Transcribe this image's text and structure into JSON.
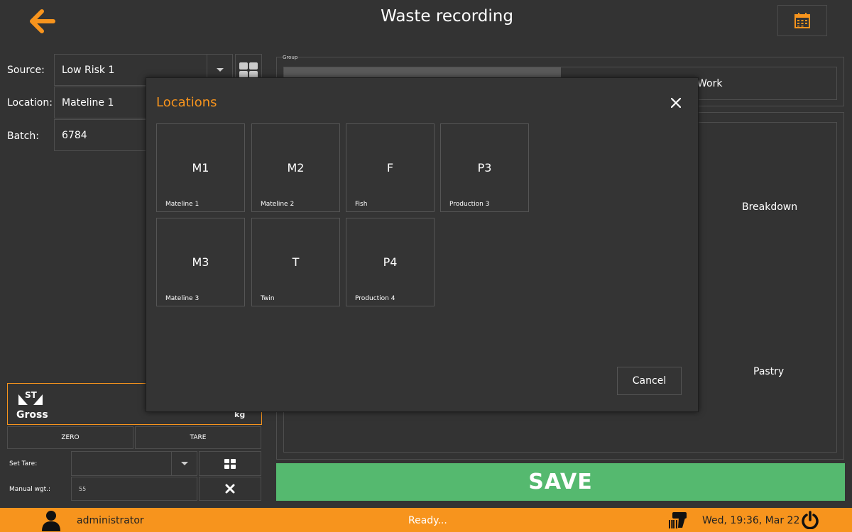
{
  "header": {
    "title": "Waste recording",
    "back_icon": "arrow-left-icon",
    "calendar_icon": "calendar-icon",
    "accent_color": "#f7941d"
  },
  "form": {
    "source_label": "Source:",
    "source_value": "Low Risk 1",
    "location_label": "Location:",
    "location_value": "Mateline 1",
    "batch_label": "Batch:",
    "batch_value": "6784"
  },
  "group": {
    "legend": "Group",
    "partial_label": "Work"
  },
  "categories": {
    "breakdown": "Breakdown",
    "pastry": "Pastry"
  },
  "weight": {
    "stability_icon": "stable-weight-icon",
    "stability_label": "ST",
    "mode": "Gross",
    "unit": "kg",
    "zero_label": "ZERO",
    "tare_label": "TARE",
    "set_tare_label": "Set Tare:",
    "set_tare_value": "",
    "manual_label": "Manual wgt.:",
    "manual_value": "55"
  },
  "save_label": "SAVE",
  "save_color": "#55b96f",
  "footer": {
    "user": "administrator",
    "status": "Ready...",
    "datetime": "Wed, 19:36, Mar 22"
  },
  "modal": {
    "title": "Locations",
    "cancel_label": "Cancel",
    "tiles": [
      {
        "code": "M1",
        "name": "Mateline 1"
      },
      {
        "code": "M2",
        "name": "Mateline 2"
      },
      {
        "code": "F",
        "name": "Fish"
      },
      {
        "code": "P3",
        "name": "Production 3"
      },
      {
        "code": "M3",
        "name": "Mateline 3"
      },
      {
        "code": "T",
        "name": "Twin"
      },
      {
        "code": "P4",
        "name": "Production 4"
      }
    ]
  }
}
